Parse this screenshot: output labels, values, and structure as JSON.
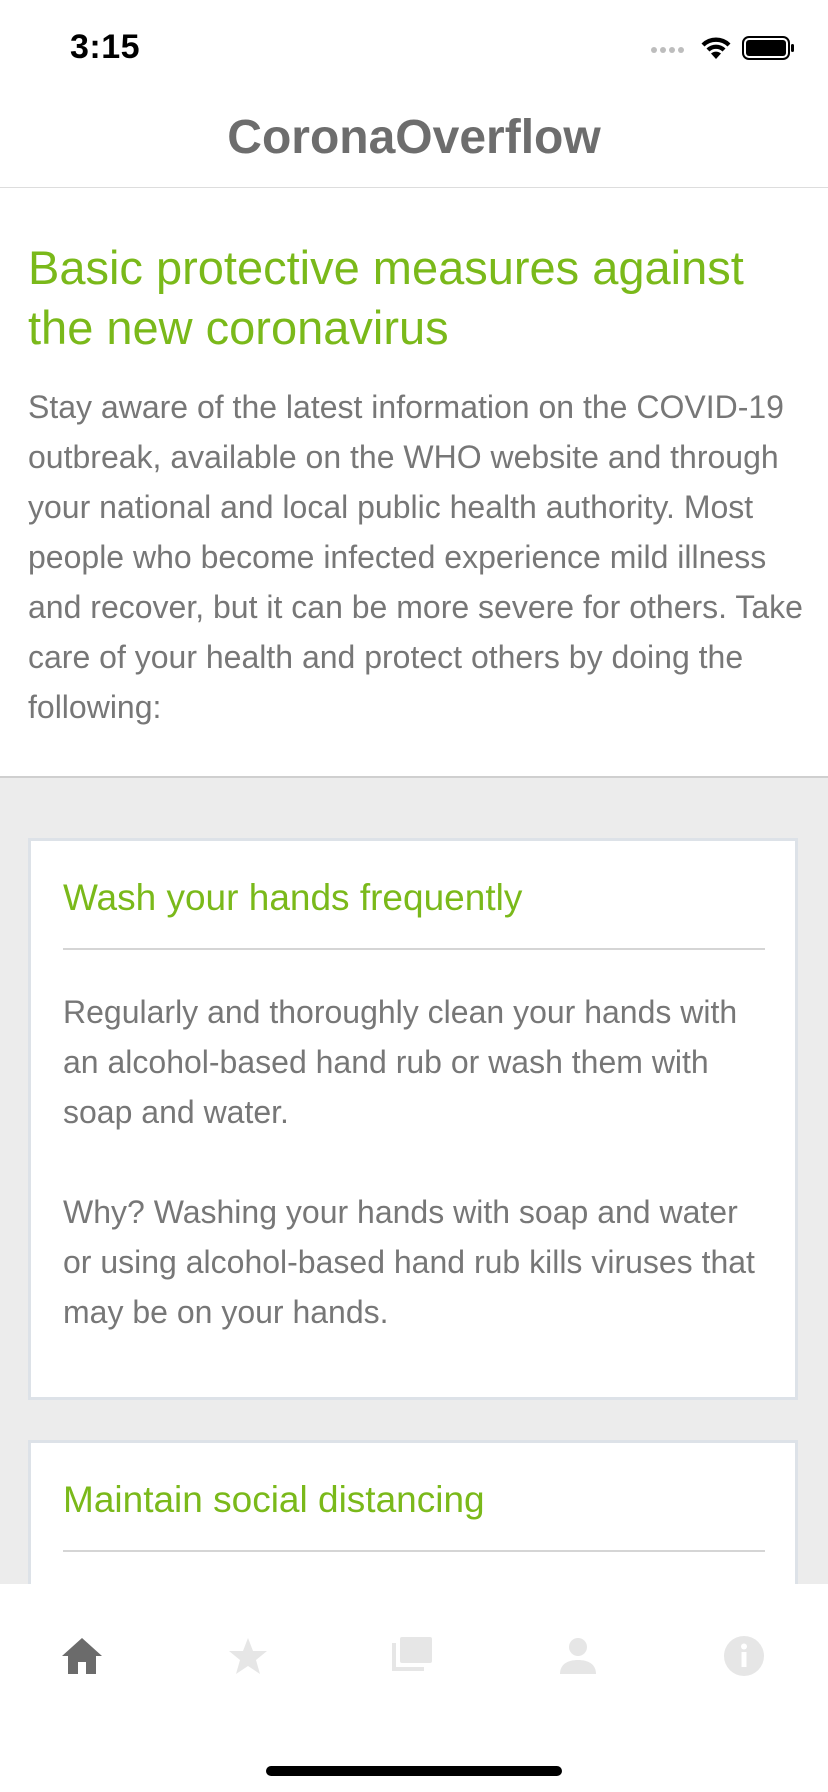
{
  "status_bar": {
    "time": "3:15",
    "icons": [
      "cellular-signal-icon",
      "wifi-icon",
      "battery-icon"
    ]
  },
  "nav": {
    "title": "CoronaOverflow"
  },
  "intro": {
    "heading": "Basic protective measures against the new coronavirus",
    "body": "Stay aware of the latest information on the COVID-19 outbreak, available on the WHO website and through your national and local public health authority. Most people who become infected experience mild illness and recover, but it can be more severe for others. Take care of your health and protect others by doing the following:"
  },
  "cards": [
    {
      "title": "Wash your hands frequently",
      "text": "Regularly and thoroughly clean your hands with an alcohol-based hand rub or wash them with soap and water.",
      "why": "Why? Washing your hands with soap and water or using alcohol-based hand rub kills viruses that may be on your hands."
    },
    {
      "title": "Maintain social distancing"
    }
  ],
  "tab_bar": {
    "tabs": [
      {
        "icon": "home-icon",
        "active": true
      },
      {
        "icon": "star-icon",
        "active": false
      },
      {
        "icon": "forum-icon",
        "active": false
      },
      {
        "icon": "person-icon",
        "active": false
      },
      {
        "icon": "info-icon",
        "active": false
      }
    ]
  },
  "colors": {
    "accent_green": "#7ab91a",
    "text_gray": "#777777",
    "title_gray": "#6d6d6d",
    "tab_active": "#6b6b6b",
    "tab_inactive": "#e6e6e6",
    "cards_background": "#ececec"
  }
}
